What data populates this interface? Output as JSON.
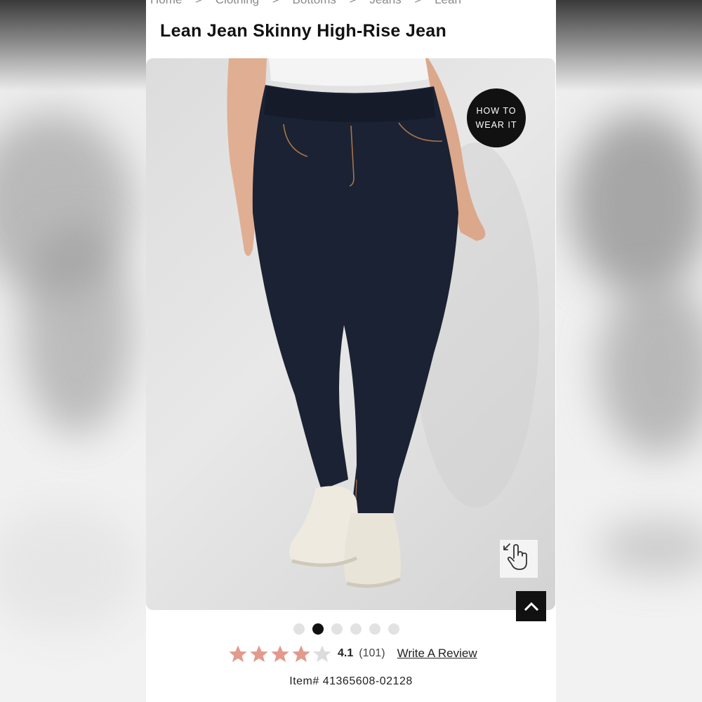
{
  "breadcrumb": [
    "Home",
    "Clothing",
    "Bottoms",
    "Jeans",
    "Lean"
  ],
  "breadcrumb_separator": ">",
  "product": {
    "title": "Lean Jean Skinny High-Rise Jean",
    "item_label": "Item# 41365608-02128"
  },
  "hero": {
    "how_to_line1": "HOW TO",
    "how_to_line2": "WEAR IT",
    "image_subject": "model wearing dark wash skinny jeans and white sneakers"
  },
  "carousel": {
    "total": 6,
    "active_index": 1
  },
  "rating": {
    "value": "4.1",
    "stars": 4.1,
    "count": "(101)",
    "write_review": "Write A Review"
  },
  "colors": {
    "star_fill": "#e29a8c",
    "star_empty": "#dcdcdc",
    "accent_dark": "#111111",
    "denim": "#1b2233"
  },
  "icons": [
    "expand-gesture-icon",
    "chevron-up-icon",
    "star-icon"
  ]
}
